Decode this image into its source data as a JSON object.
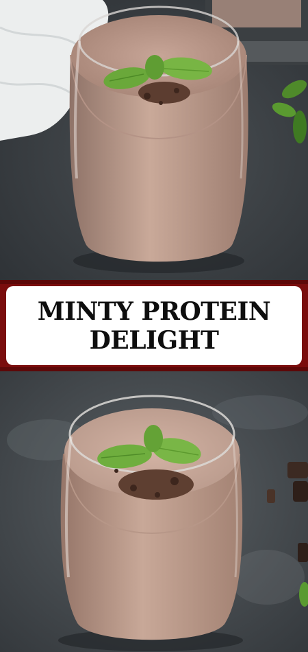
{
  "banner": {
    "title_lines": [
      "MINTY PROTEIN",
      "DELIGHT"
    ],
    "background_color": "#7a0d0d",
    "card_color": "#ffffff",
    "text_color": "#0e0e0e"
  },
  "photos": [
    {
      "subject": "glass-of-chocolate-mint-smoothie",
      "garnish": "mint-leaves-and-chocolate-shavings"
    },
    {
      "subject": "glass-of-chocolate-mint-smoothie",
      "garnish": "mint-leaves-and-chocolate-shavings"
    }
  ]
}
